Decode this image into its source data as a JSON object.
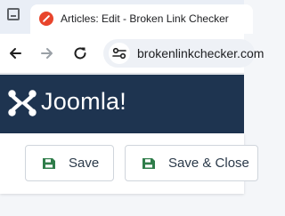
{
  "browser": {
    "active_tab": {
      "title": "Articles: Edit - Broken Link Checker"
    },
    "address_bar": {
      "url": "brokenlinkchecker.com"
    }
  },
  "header": {
    "logo_text": "Joomla!"
  },
  "toolbar": {
    "save_label": "Save",
    "save_close_label": "Save & Close"
  },
  "colors": {
    "header_bg": "#1e3450",
    "save_icon": "#2f7d4a",
    "favicon": "#e8452c"
  }
}
